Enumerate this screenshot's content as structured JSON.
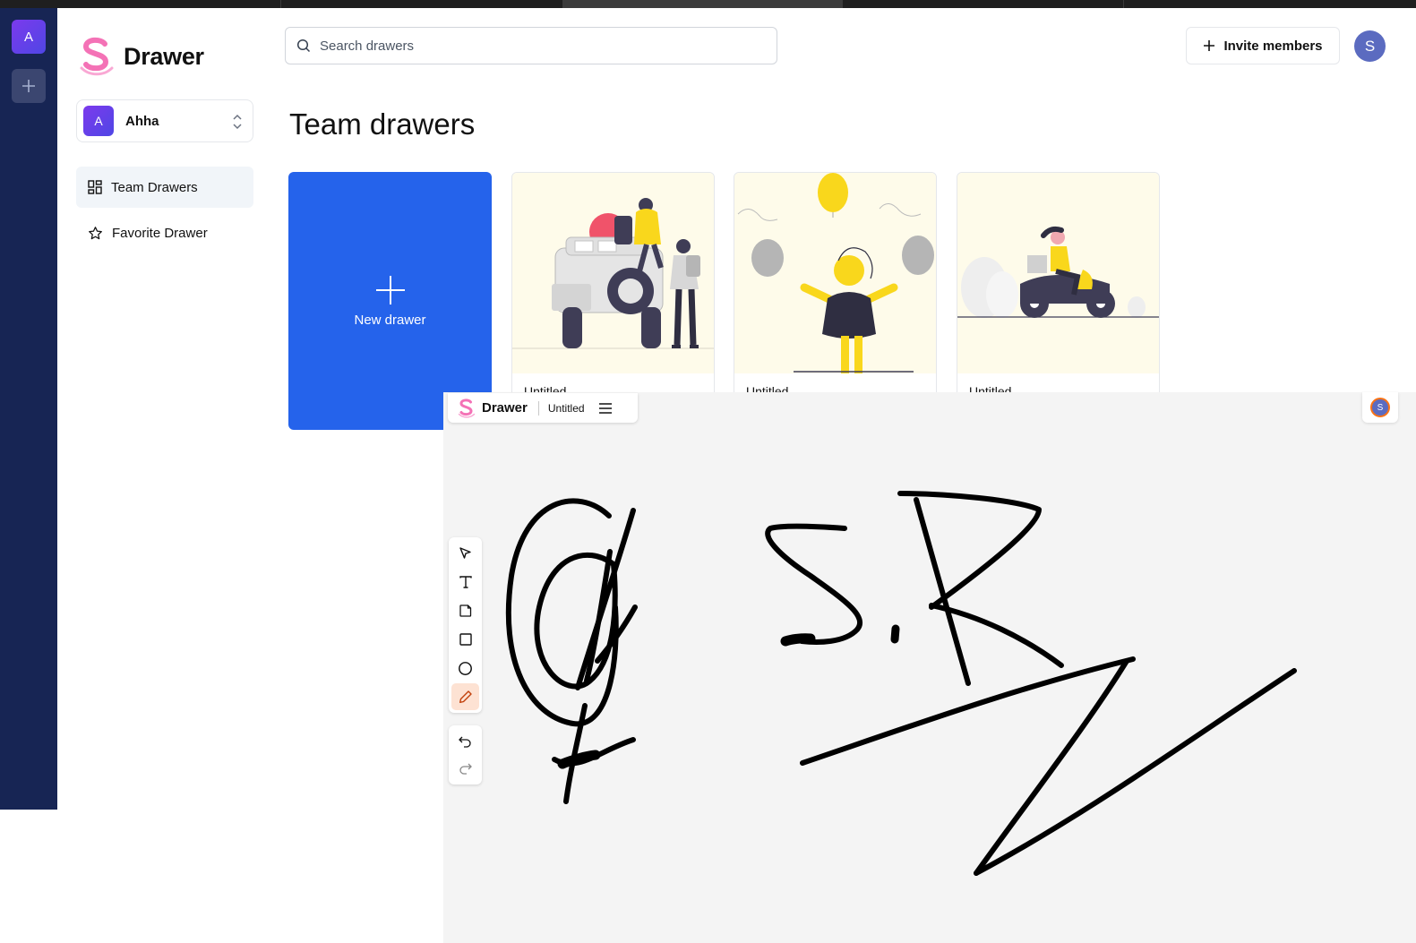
{
  "app": {
    "name": "Drawer"
  },
  "rail": {
    "team_initial": "A"
  },
  "sidebar": {
    "team": {
      "initial": "A",
      "name": "Ahha"
    },
    "items": [
      {
        "label": "Team Drawers",
        "icon": "grid-icon",
        "active": true
      },
      {
        "label": "Favorite Drawer",
        "icon": "star-icon",
        "active": false
      }
    ]
  },
  "header": {
    "search_placeholder": "Search drawers",
    "invite_label": "Invite members",
    "user_initial": "S"
  },
  "main": {
    "title": "Team drawers",
    "new_drawer_label": "New drawer",
    "cards": [
      {
        "title": "Untitled",
        "illustration": "jeep-travelers"
      },
      {
        "title": "Untitled",
        "illustration": "balloons-person"
      },
      {
        "title": "Untitled",
        "illustration": "scooter-rider"
      }
    ]
  },
  "canvas": {
    "brand": "Drawer",
    "doc_title": "Untitled",
    "user_initial": "S",
    "tools": [
      "pointer-icon",
      "text-icon",
      "sticky-note-icon",
      "rectangle-icon",
      "ellipse-icon",
      "pencil-icon"
    ],
    "selected_tool": "pencil-icon",
    "history": [
      "undo-icon",
      "redo-icon"
    ],
    "stroke_color": "#000000",
    "accent_color": "#fde2d3"
  },
  "colors": {
    "primary": "#2563eb",
    "rail": "#172554",
    "logo_pink": "#f472b6"
  }
}
